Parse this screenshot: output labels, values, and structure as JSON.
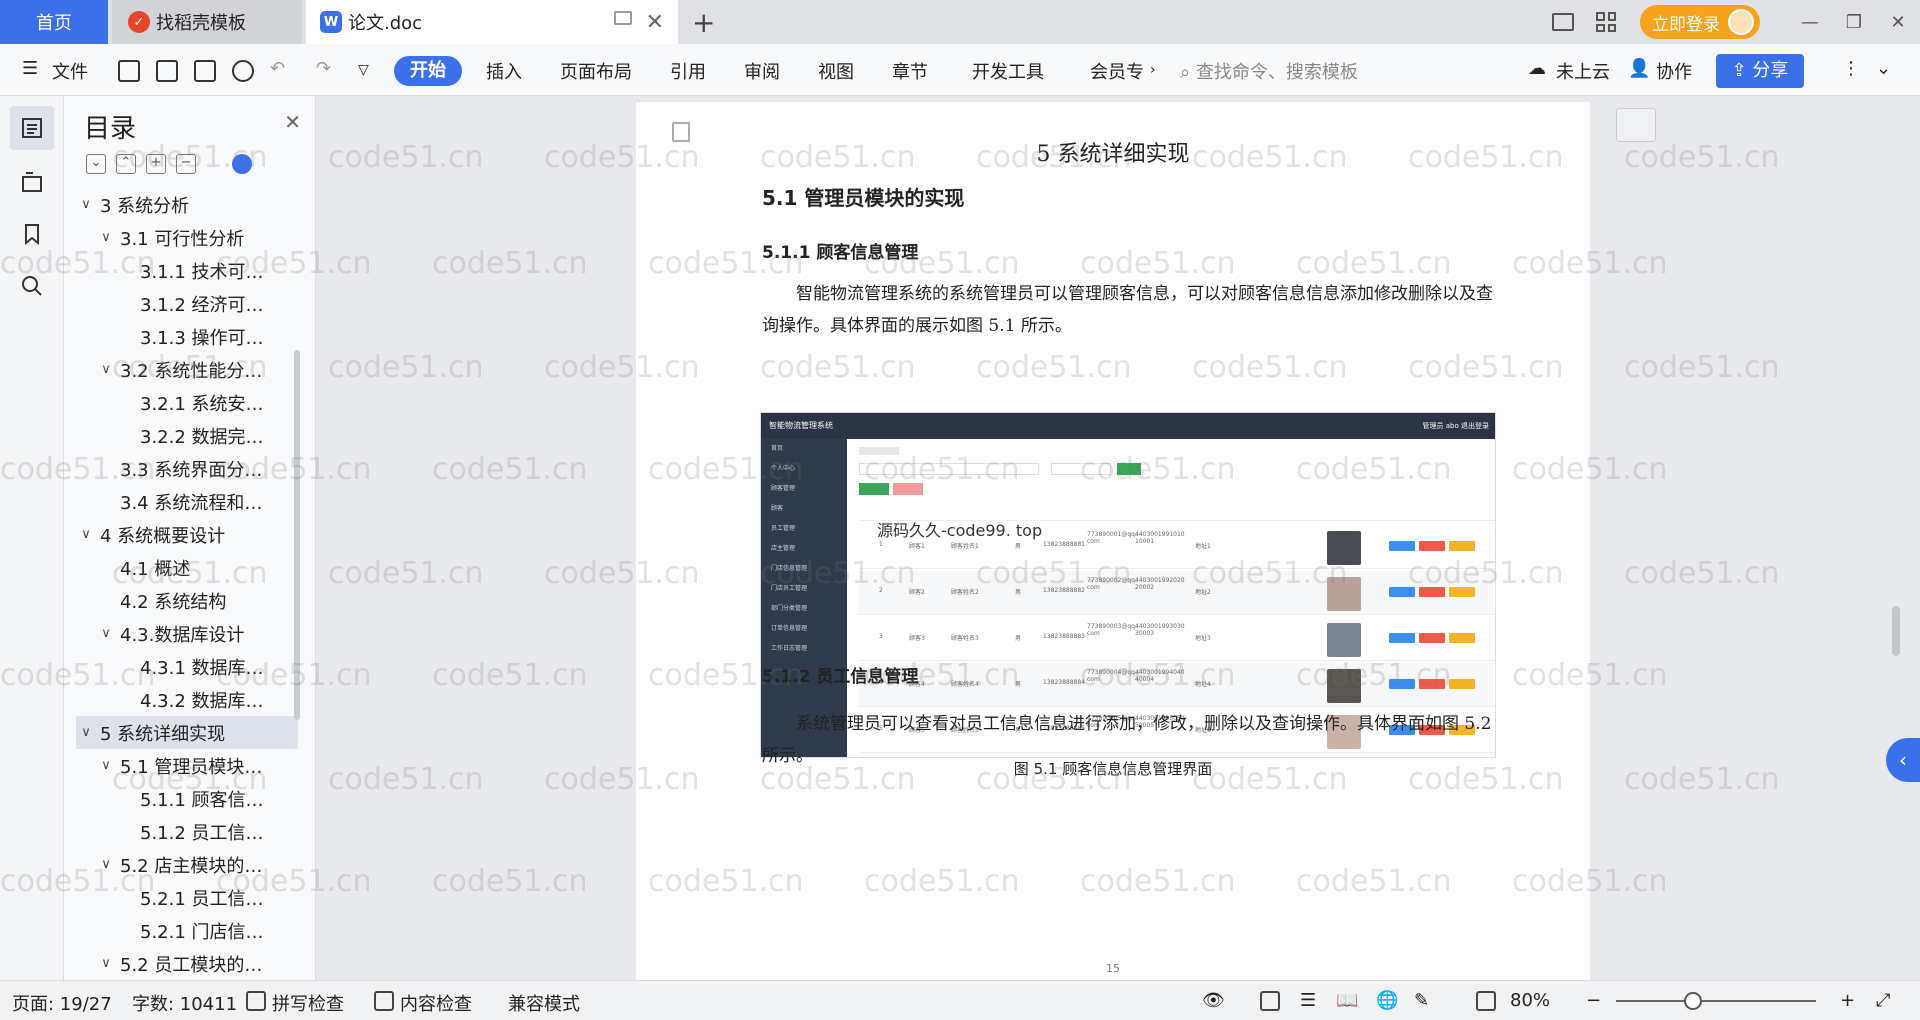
{
  "tabs": [
    {
      "label": "首页"
    },
    {
      "label": "找稻壳模板"
    },
    {
      "label": "论文.doc"
    }
  ],
  "header": {
    "login_label": "立即登录"
  },
  "ribbon": {
    "file_label": "文件",
    "menus": [
      "开始",
      "插入",
      "页面布局",
      "引用",
      "审阅",
      "视图",
      "章节",
      "开发工具",
      "会员专"
    ],
    "search_placeholder": "查找命令、搜索模板",
    "cloud_label": "未上云",
    "collab_label": "协作",
    "share_label": "分享"
  },
  "toc": {
    "title": "目录",
    "items": [
      {
        "label": "3 系统分析",
        "level": 0,
        "arrow": true
      },
      {
        "label": "3.1 可行性分析",
        "level": 1,
        "arrow": true
      },
      {
        "label": "3.1.1 技术可…",
        "level": 2,
        "arrow": false
      },
      {
        "label": "3.1.2 经济可…",
        "level": 2,
        "arrow": false
      },
      {
        "label": "3.1.3 操作可…",
        "level": 2,
        "arrow": false
      },
      {
        "label": "3.2 系统性能分…",
        "level": 1,
        "arrow": true
      },
      {
        "label": "3.2.1  系统安…",
        "level": 2,
        "arrow": false
      },
      {
        "label": "3.2.2  数据完…",
        "level": 2,
        "arrow": false
      },
      {
        "label": "3.3 系统界面分…",
        "level": 1,
        "arrow": false
      },
      {
        "label": "3.4 系统流程和…",
        "level": 1,
        "arrow": false
      },
      {
        "label": "4 系统概要设计",
        "level": 0,
        "arrow": true
      },
      {
        "label": "4.1 概述",
        "level": 1,
        "arrow": false
      },
      {
        "label": "4.2 系统结构",
        "level": 1,
        "arrow": false
      },
      {
        "label": "4.3.数据库设计",
        "level": 1,
        "arrow": true
      },
      {
        "label": "4.3.1 数据库…",
        "level": 2,
        "arrow": false
      },
      {
        "label": "4.3.2 数据库…",
        "level": 2,
        "arrow": false
      },
      {
        "label": "5 系统详细实现",
        "level": 0,
        "arrow": true,
        "selected": true
      },
      {
        "label": "5.1  管理员模块…",
        "level": 1,
        "arrow": true
      },
      {
        "label": "5.1.1  顾客信…",
        "level": 2,
        "arrow": false
      },
      {
        "label": "5.1.2  员工信…",
        "level": 2,
        "arrow": false
      },
      {
        "label": "5.2  店主模块的…",
        "level": 1,
        "arrow": true
      },
      {
        "label": "5.2.1  员工信…",
        "level": 2,
        "arrow": false
      },
      {
        "label": "5.2.1  门店信…",
        "level": 2,
        "arrow": false
      },
      {
        "label": "5.2  员工模块的…",
        "level": 1,
        "arrow": true
      }
    ]
  },
  "document": {
    "chapter_title": "5 系统详细实现",
    "h2": "5.1  管理员模块的实现",
    "h3_a": "5.1.1  顾客信息管理",
    "para_a": "智能物流管理系统的系统管理员可以管理顾客信息，可以对顾客信息信息添加修改删除以及查询操作。具体界面的展示如图 5.1 所示。",
    "figure_caption": "图 5.1  顾客信息信息管理界面",
    "h3_b": "5.1.2  员工信息管理",
    "para_b": "系统管理员可以查看对员工信息信息进行添加，修改，删除以及查询操作。具体界面如图 5.2 所示。",
    "page_number": "15",
    "figure": {
      "app_title": "智能物流管理系统",
      "user_label": "管理员 abo    退出登录",
      "overlay_text": "源码久久-code99. top",
      "sidebar": [
        "首页",
        "个人中心",
        "顾客管理",
        "顾客",
        "员工管理",
        "店主管理",
        "门店信息管理",
        "门店员工管理",
        "部门分类管理",
        "订单信息管理",
        "工作日志管理"
      ],
      "rows": [
        {
          "no": "1",
          "name": "顾客1",
          "alias": "顾客姓名1",
          "sex": "男",
          "phone": "13823888881",
          "email": "773890001@qq.com",
          "id": "440300199101010001",
          "addr": "地址1"
        },
        {
          "no": "2",
          "name": "顾客2",
          "alias": "顾客姓名2",
          "sex": "男",
          "phone": "13823888882",
          "email": "773890002@qq.com",
          "id": "440300199202020002",
          "addr": "地址2"
        },
        {
          "no": "3",
          "name": "顾客3",
          "alias": "顾客姓名3",
          "sex": "男",
          "phone": "13823888883",
          "email": "773890003@qq.com",
          "id": "440300199303030003",
          "addr": "地址3"
        },
        {
          "no": "4",
          "name": "顾客4",
          "alias": "顾客姓名4",
          "sex": "男",
          "phone": "13823888884",
          "email": "773890004@qq.com",
          "id": "440300199404040004",
          "addr": "地址4"
        },
        {
          "no": "5",
          "name": "顾客5",
          "alias": "顾客姓名5",
          "sex": "男",
          "phone": "13823888885",
          "email": "773890005@qq.com",
          "id": "440300199505050005",
          "addr": "地址5"
        }
      ]
    }
  },
  "watermark": "code51.cn",
  "status": {
    "page": "页面: 19/27",
    "words": "字数: 10411",
    "spell": "拼写检查",
    "content": "内容检查",
    "compat": "兼容模式",
    "zoom": "80%"
  },
  "colors": {
    "accent": "#3c70e8",
    "login": "#f7a21b"
  }
}
